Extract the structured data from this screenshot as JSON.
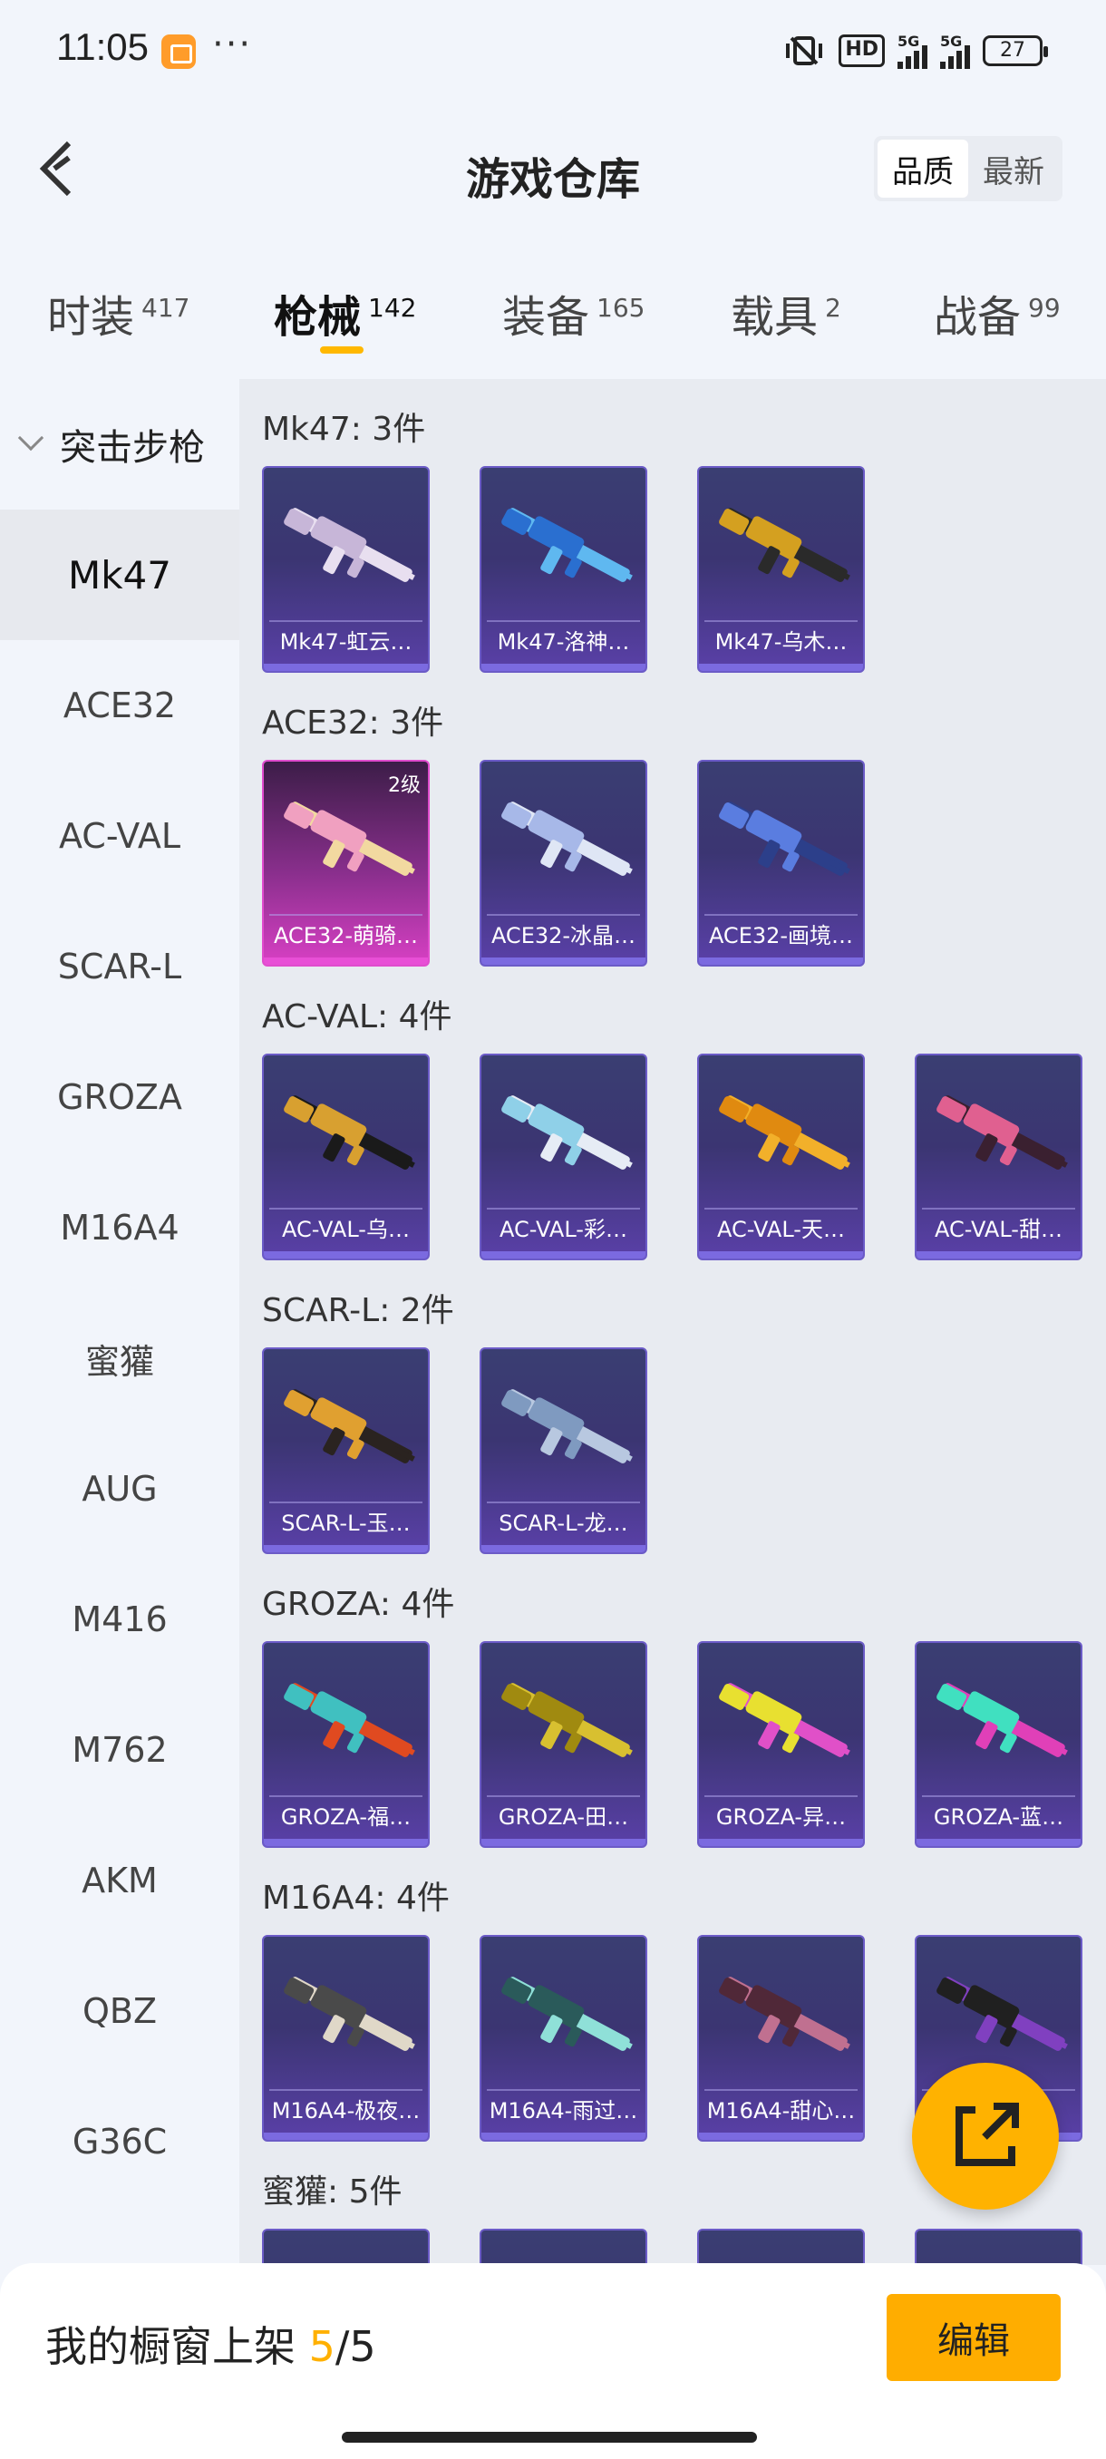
{
  "status_bar": {
    "time": "11:05",
    "dots": "···",
    "hd": "HD",
    "net1": "5G",
    "net2": "5G",
    "battery": "27"
  },
  "header": {
    "title": "游戏仓库",
    "toggle": [
      "品质",
      "最新"
    ]
  },
  "tabs": [
    {
      "label": "时装",
      "count": "417"
    },
    {
      "label": "枪械",
      "count": "142"
    },
    {
      "label": "装备",
      "count": "165"
    },
    {
      "label": "载具",
      "count": "2"
    },
    {
      "label": "战备",
      "count": "99"
    }
  ],
  "sidebar": {
    "group": "突击步枪",
    "items": [
      "Mk47",
      "ACE32",
      "AC-VAL",
      "SCAR-L",
      "GROZA",
      "M16A4",
      "蜜獾",
      "AUG",
      "M416",
      "M762",
      "AKM",
      "QBZ",
      "G36C"
    ]
  },
  "sections": [
    {
      "title": "Mk47: 3件",
      "items": [
        {
          "name": "Mk47-虹云…",
          "c1": "#e8dff0",
          "c2": "#c7b6d8"
        },
        {
          "name": "Mk47-洛神…",
          "c1": "#5fb8f0",
          "c2": "#2a6fd0"
        },
        {
          "name": "Mk47-乌木…",
          "c1": "#2a2a2a",
          "c2": "#d4a020"
        }
      ]
    },
    {
      "title": "ACE32: 3件",
      "items": [
        {
          "name": "ACE32-萌骑…",
          "c1": "#f2d9a0",
          "c2": "#f0a0c0",
          "level": "2级",
          "pink": true
        },
        {
          "name": "ACE32-冰晶…",
          "c1": "#dfe6f5",
          "c2": "#a7b8e8"
        },
        {
          "name": "ACE32-画境…",
          "c1": "#2c3f8a",
          "c2": "#5a7de0"
        }
      ]
    },
    {
      "title": "AC-VAL: 4件",
      "items": [
        {
          "name": "AC-VAL-乌…",
          "c1": "#1a1a1a",
          "c2": "#d8a030"
        },
        {
          "name": "AC-VAL-彩…",
          "c1": "#e6ecf5",
          "c2": "#8fd0e8"
        },
        {
          "name": "AC-VAL-天…",
          "c1": "#f2b02a",
          "c2": "#e08a10"
        },
        {
          "name": "AC-VAL-甜…",
          "c1": "#3a2030",
          "c2": "#e06090"
        }
      ]
    },
    {
      "title": "SCAR-L: 2件",
      "items": [
        {
          "name": "SCAR-L-玉…",
          "c1": "#2a2320",
          "c2": "#e0a030"
        },
        {
          "name": "SCAR-L-龙…",
          "c1": "#b8c8e0",
          "c2": "#7f9ac0"
        }
      ]
    },
    {
      "title": "GROZA: 4件",
      "items": [
        {
          "name": "GROZA-福…",
          "c1": "#e04a20",
          "c2": "#40c0c0"
        },
        {
          "name": "GROZA-田…",
          "c1": "#d8c030",
          "c2": "#a08a10"
        },
        {
          "name": "GROZA-异…",
          "c1": "#e050c8",
          "c2": "#e8e030"
        },
        {
          "name": "GROZA-蓝…",
          "c1": "#e040b8",
          "c2": "#40e0c0"
        }
      ]
    },
    {
      "title": "M16A4: 4件",
      "items": [
        {
          "name": "M16A4-极夜…",
          "c1": "#e0d8c8",
          "c2": "#4a4a4a"
        },
        {
          "name": "M16A4-雨过…",
          "c1": "#8fe0d8",
          "c2": "#2a5a5a"
        },
        {
          "name": "M16A4-甜心…",
          "c1": "#c07090",
          "c2": "#502838"
        },
        {
          "name": "M16A4-…",
          "c1": "#8040c0",
          "c2": "#202020"
        }
      ]
    },
    {
      "title": "蜜獾: 5件",
      "items": [
        {
          "name": "",
          "c1": "#3a3e72",
          "c2": "#3a3e72"
        },
        {
          "name": "",
          "c1": "#3a3e72",
          "c2": "#3a3e72"
        },
        {
          "name": "",
          "c1": "#3a3e72",
          "c2": "#3a3e72"
        },
        {
          "name": "",
          "c1": "#3a3e72",
          "c2": "#3a3e72"
        }
      ]
    }
  ],
  "bottom_bar": {
    "label": "我的橱窗上架 ",
    "current": "5",
    "sep": "/",
    "total": "5",
    "edit": "编辑"
  },
  "colors": {
    "accent": "#ffb200",
    "card": "#3b3572",
    "card_rare": "#d840c4"
  },
  "icons": {
    "back": "back-arrow-icon",
    "fab": "share-external-icon"
  }
}
